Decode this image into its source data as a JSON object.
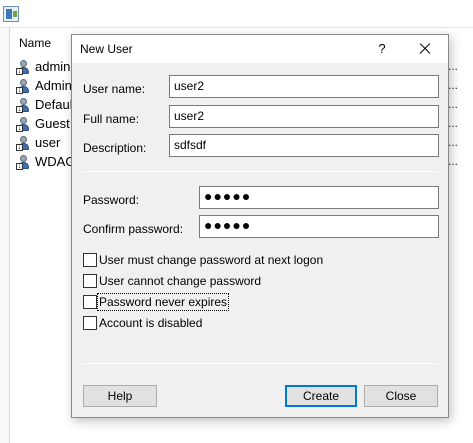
{
  "background": {
    "column_header": "Name",
    "users": [
      "admin",
      "Admin",
      "Default",
      "Guest",
      "user",
      "WDAG"
    ],
    "row_ellipsis": [
      "...",
      "...",
      "...",
      "...",
      "...",
      "..."
    ]
  },
  "dialog": {
    "title": "New User",
    "help_glyph": "?",
    "fields": {
      "user_name_label": "User name:",
      "user_name_value": "user2",
      "full_name_label": "Full name:",
      "full_name_value": "user2",
      "description_label": "Description:",
      "description_value": "sdfsdf",
      "password_label": "Password:",
      "password_value": "●●●●●",
      "confirm_label": "Confirm password:",
      "confirm_value": "●●●●●"
    },
    "checkboxes": [
      {
        "label": "User must change password at next logon",
        "checked": false
      },
      {
        "label": "User cannot change password",
        "checked": false
      },
      {
        "label": "Password never expires",
        "checked": false
      },
      {
        "label": "Account is disabled",
        "checked": false
      }
    ],
    "buttons": {
      "help": "Help",
      "create": "Create",
      "close": "Close"
    }
  }
}
